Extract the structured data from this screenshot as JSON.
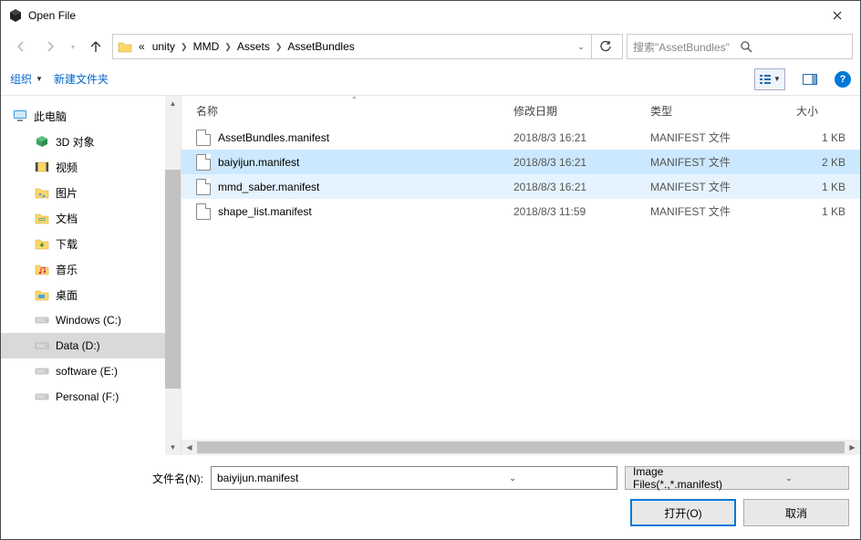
{
  "window": {
    "title": "Open File"
  },
  "breadcrumb": {
    "prefix": "«",
    "segments": [
      "unity",
      "MMD",
      "Assets",
      "AssetBundles"
    ]
  },
  "search": {
    "placeholder": "搜索\"AssetBundles\""
  },
  "toolbar": {
    "organize": "组织",
    "new_folder": "新建文件夹"
  },
  "sidebar": {
    "root": "此电脑",
    "items": [
      {
        "label": "3D 对象",
        "icon": "cube"
      },
      {
        "label": "视频",
        "icon": "video"
      },
      {
        "label": "图片",
        "icon": "pictures"
      },
      {
        "label": "文档",
        "icon": "docs"
      },
      {
        "label": "下载",
        "icon": "downloads"
      },
      {
        "label": "音乐",
        "icon": "music"
      },
      {
        "label": "桌面",
        "icon": "desktop"
      },
      {
        "label": "Windows (C:)",
        "icon": "drive"
      },
      {
        "label": "Data (D:)",
        "icon": "drive",
        "selected": true
      },
      {
        "label": "software (E:)",
        "icon": "drive"
      },
      {
        "label": "Personal (F:)",
        "icon": "drive"
      }
    ]
  },
  "columns": {
    "name": "名称",
    "date": "修改日期",
    "type": "类型",
    "size": "大小"
  },
  "files": [
    {
      "name": "AssetBundles.manifest",
      "date": "2018/8/3 16:21",
      "type": "MANIFEST 文件",
      "size": "1 KB",
      "state": ""
    },
    {
      "name": "baiyijun.manifest",
      "date": "2018/8/3 16:21",
      "type": "MANIFEST 文件",
      "size": "2 KB",
      "state": "selected"
    },
    {
      "name": "mmd_saber.manifest",
      "date": "2018/8/3 16:21",
      "type": "MANIFEST 文件",
      "size": "1 KB",
      "state": "hover"
    },
    {
      "name": "shape_list.manifest",
      "date": "2018/8/3 11:59",
      "type": "MANIFEST 文件",
      "size": "1 KB",
      "state": ""
    }
  ],
  "footer": {
    "filename_label": "文件名(N):",
    "filename_value": "baiyijun.manifest",
    "filter_label": "Image Files(*.,*.manifest)",
    "open": "打开(O)",
    "cancel": "取消"
  }
}
